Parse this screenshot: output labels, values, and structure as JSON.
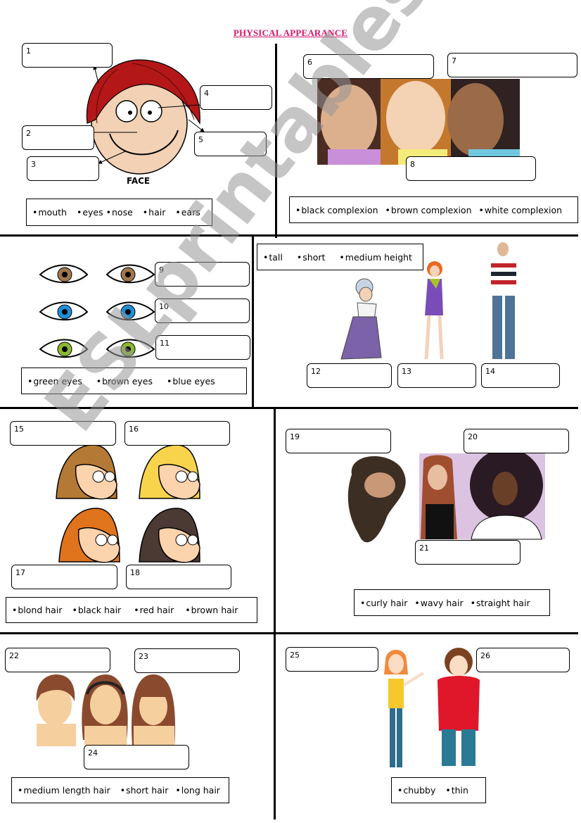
{
  "title": "PHYSICAL APPEARANCE",
  "watermark": "ESLprintables.com",
  "colors": {
    "title": "#d6166c",
    "lines": "#000000"
  },
  "sections": {
    "face": {
      "caption": "FACE",
      "boxes": [
        "1",
        "2",
        "3",
        "4",
        "5"
      ],
      "word_bank": [
        "mouth",
        "eyes",
        "nose",
        "hair",
        "ears"
      ]
    },
    "complexion": {
      "boxes": [
        "6",
        "7",
        "8"
      ],
      "word_bank": [
        "black complexion",
        "brown complexion",
        "white complexion"
      ]
    },
    "eyes": {
      "boxes": [
        "9",
        "10",
        "11"
      ],
      "eye_colors": [
        "#a0764e",
        "#1e8fd6",
        "#8cb832"
      ],
      "word_bank": [
        "green eyes",
        "brown eyes",
        "blue eyes"
      ]
    },
    "height": {
      "boxes": [
        "12",
        "13",
        "14"
      ],
      "word_bank": [
        "tall",
        "short",
        "medium height"
      ]
    },
    "hair_color": {
      "boxes": [
        "15",
        "16",
        "17",
        "18"
      ],
      "hair_colors": [
        "#b47a35",
        "#f7d44c",
        "#e0741c",
        "#4a3a33"
      ],
      "word_bank": [
        "blond hair",
        "black hair",
        "red hair",
        "brown hair"
      ]
    },
    "hair_type": {
      "boxes": [
        "19",
        "20",
        "21"
      ],
      "word_bank": [
        "curly hair",
        "wavy hair",
        "straight hair"
      ]
    },
    "hair_length": {
      "boxes": [
        "22",
        "23",
        "24"
      ],
      "word_bank": [
        "medium length hair",
        "short hair",
        "long hair"
      ]
    },
    "body": {
      "boxes": [
        "25",
        "26"
      ],
      "word_bank": [
        "chubby",
        "thin"
      ]
    }
  }
}
